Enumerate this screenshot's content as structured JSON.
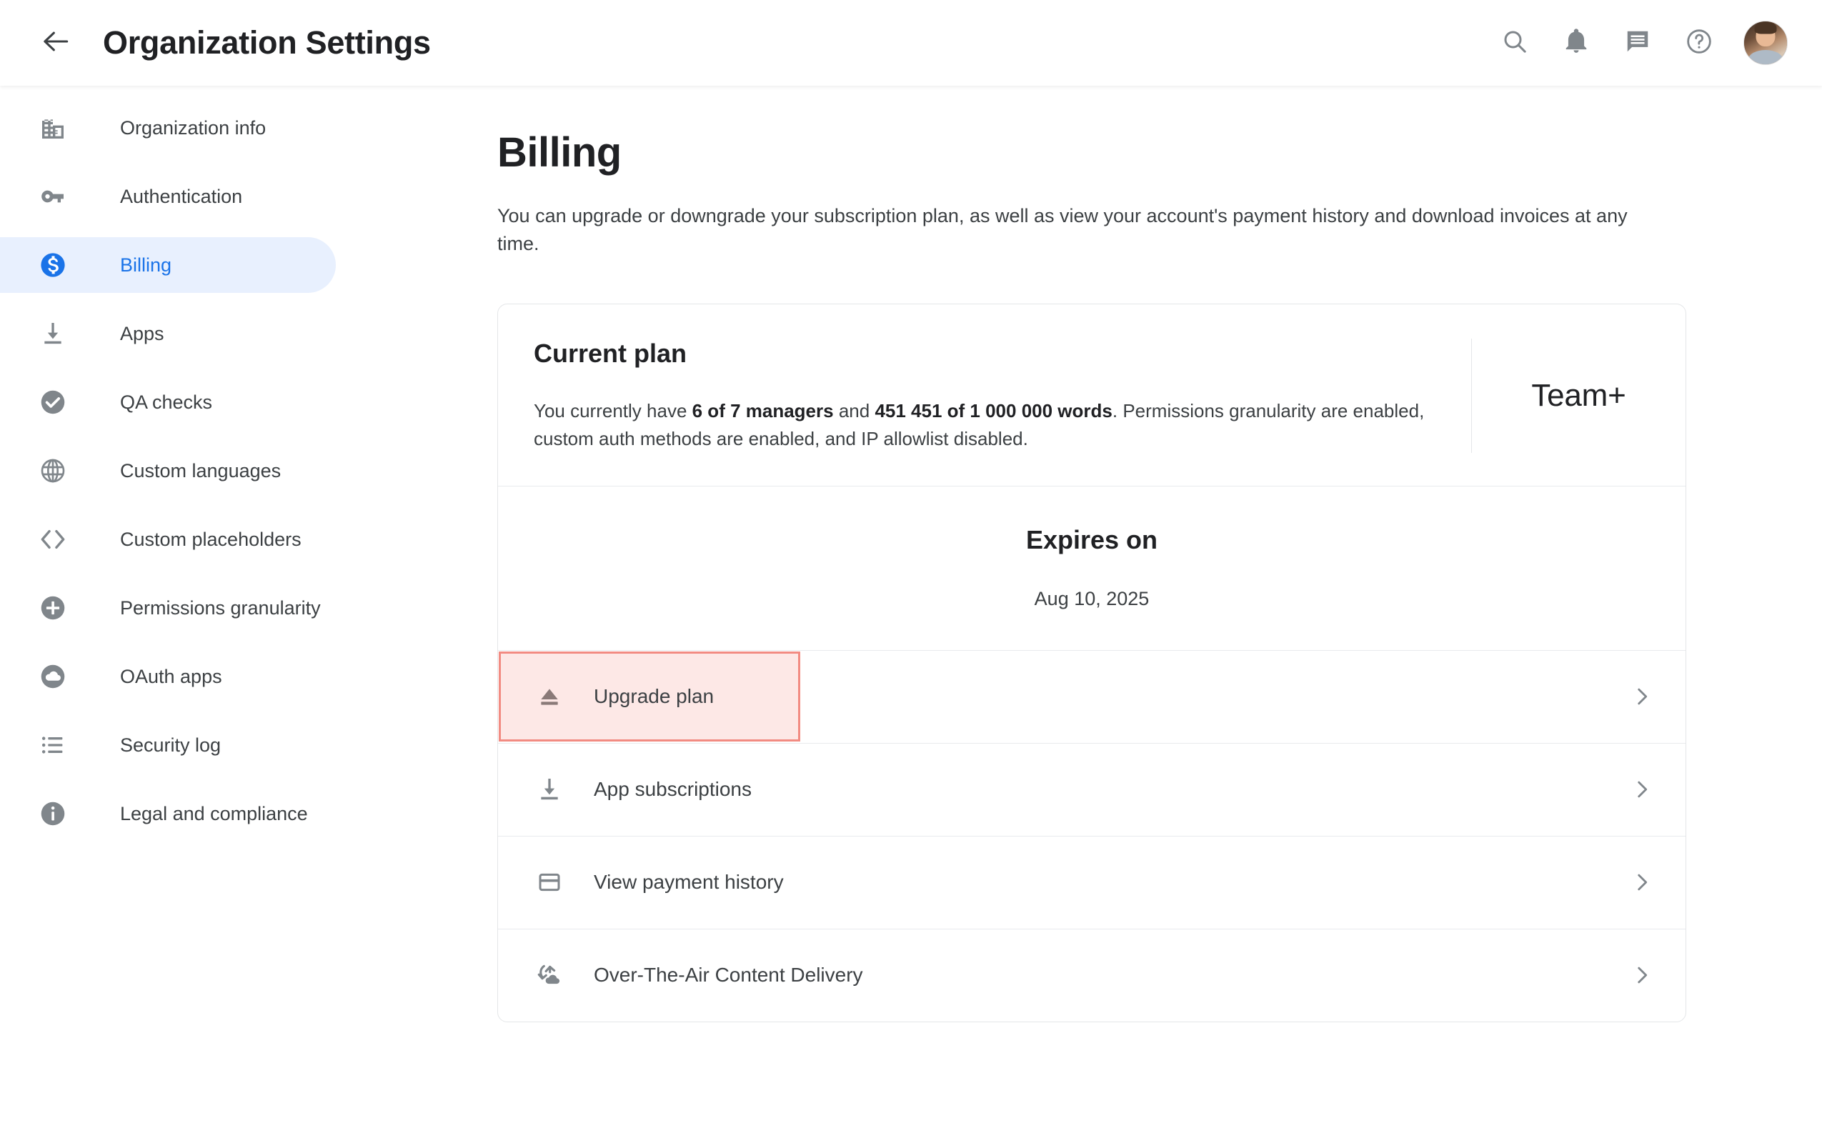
{
  "header": {
    "title": "Organization Settings",
    "back_icon": "arrow-left-icon",
    "icons": [
      {
        "name": "search-icon",
        "label": "Search"
      },
      {
        "name": "notifications-bell-icon",
        "label": "Notifications"
      },
      {
        "name": "chat-message-icon",
        "label": "Messages"
      },
      {
        "name": "help-question-icon",
        "label": "Help"
      }
    ],
    "avatar_label": "User account"
  },
  "sidebar": {
    "items": [
      {
        "label": "Organization info",
        "icon": "office-building-icon",
        "active": false
      },
      {
        "label": "Authentication",
        "icon": "key-icon",
        "active": false
      },
      {
        "label": "Billing",
        "icon": "dollar-circle-icon",
        "active": true
      },
      {
        "label": "Apps",
        "icon": "download-icon",
        "active": false
      },
      {
        "label": "QA checks",
        "icon": "check-circle-icon",
        "active": false
      },
      {
        "label": "Custom languages",
        "icon": "globe-icon",
        "active": false
      },
      {
        "label": "Custom placeholders",
        "icon": "code-brackets-icon",
        "active": false
      },
      {
        "label": "Permissions granularity",
        "icon": "plus-circle-icon",
        "active": false
      },
      {
        "label": "OAuth apps",
        "icon": "cloud-circle-icon",
        "active": false
      },
      {
        "label": "Security log",
        "icon": "list-bullets-icon",
        "active": false
      },
      {
        "label": "Legal and compliance",
        "icon": "info-circle-icon",
        "active": false
      }
    ]
  },
  "main": {
    "title": "Billing",
    "description": "You can upgrade or downgrade your subscription plan, as well as view your account's payment history and download invoices at any time.",
    "current_plan": {
      "heading": "Current plan",
      "summary_part1": "You currently have ",
      "summary_managers": "6 of 7 managers",
      "summary_part2": " and ",
      "summary_words": "451 451 of 1 000 000 words",
      "summary_part3": ". Permissions granularity are enabled, custom auth methods are enabled, and IP allowlist disabled.",
      "plan_badge": "Team+"
    },
    "expires": {
      "label": "Expires on",
      "date": "Aug 10, 2025"
    },
    "actions": [
      {
        "label": "Upgrade plan",
        "icon": "eject-icon",
        "chevron": "chevron-right-icon",
        "highlighted": true
      },
      {
        "label": "App subscriptions",
        "icon": "download-icon",
        "chevron": "chevron-right-icon",
        "highlighted": false
      },
      {
        "label": "View payment history",
        "icon": "credit-card-icon",
        "chevron": "chevron-right-icon",
        "highlighted": false
      },
      {
        "label": "Over-The-Air Content Delivery",
        "icon": "cloud-sync-icon",
        "chevron": "chevron-right-icon",
        "highlighted": false
      }
    ]
  },
  "colors": {
    "accent_blue": "#1a73e8",
    "active_pill_bg": "#e8f0fe",
    "highlight_border": "#f28b82",
    "highlight_fill": "#fde8e6",
    "icon_gray": "#80868b",
    "text_primary": "#202124",
    "text_secondary": "#3c4043"
  }
}
